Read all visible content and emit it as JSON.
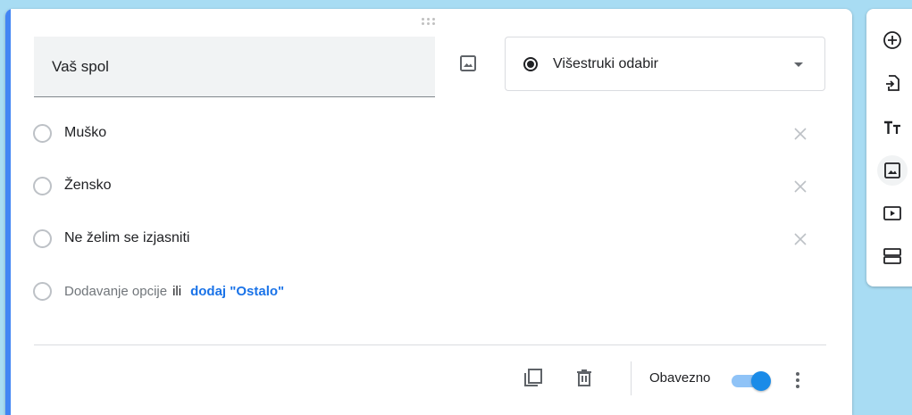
{
  "question": {
    "title": "Vaš spol",
    "type_label": "Višestruki odabir"
  },
  "options": [
    {
      "label": "Muško"
    },
    {
      "label": "Žensko"
    },
    {
      "label": "Ne želim se izjasniti"
    }
  ],
  "add_option": {
    "label": "Dodavanje opcije",
    "or": "ili",
    "other_link": "dodaj \"Ostalo\""
  },
  "footer": {
    "required_label": "Obavezno",
    "required_on": true
  },
  "colors": {
    "accent": "#4285f4",
    "link": "#1a73e8",
    "toggle": "#1a8be8",
    "background": "#a8dcf3"
  },
  "icons": {
    "image": "image-icon",
    "duplicate": "copy-icon",
    "delete": "trash-icon",
    "more": "more-vert-icon",
    "remove": "close-icon",
    "toolbar": [
      "add-circle-icon",
      "import-icon",
      "title-icon",
      "image-icon",
      "video-icon",
      "section-icon"
    ]
  }
}
